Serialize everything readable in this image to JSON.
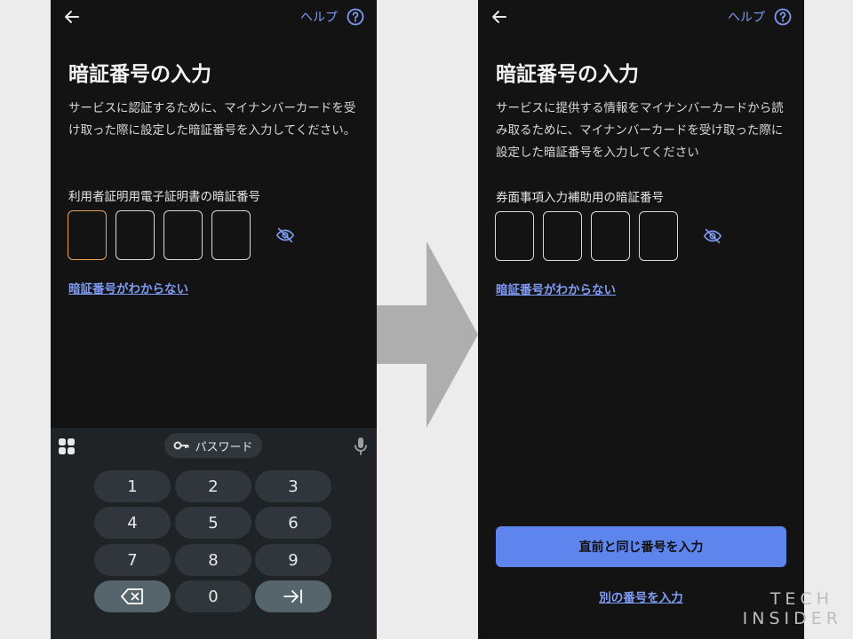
{
  "screens": [
    {
      "help_label": "ヘルプ",
      "title": "暗証番号の入力",
      "description": "サービスに認証するために、マイナンバーカードを受け取った際に設定した暗証番号を入力してください。",
      "field_label": "利用者証明用電子証明書の暗証番号",
      "pin_digits": 4,
      "focused_box": 1,
      "forgot_link": "暗証番号がわからない"
    },
    {
      "help_label": "ヘルプ",
      "title": "暗証番号の入力",
      "description": "サービスに提供する情報をマイナンバーカードから読み取るために、マイナンバーカードを受け取った際に設定した暗証番号を入力してください",
      "field_label": "券面事項入力補助用の暗証番号",
      "pin_digits": 4,
      "forgot_link": "暗証番号がわからない",
      "primary_button": "直前と同じ番号を入力",
      "secondary_link": "別の番号を入力"
    }
  ],
  "keyboard": {
    "chip_label": "パスワード",
    "keys": [
      "1",
      "2",
      "3",
      "4",
      "5",
      "6",
      "7",
      "8",
      "9",
      "0"
    ]
  },
  "logo": {
    "line1": "TECH",
    "line2": "INSIDER"
  },
  "colors": {
    "screen_bg": "#131313",
    "accent_link": "#7f9cf5",
    "focus_outline": "#e9a15a",
    "primary_button": "#5e85ee",
    "keyboard_bg": "#1f2326",
    "arrow": "#aeaeae"
  },
  "icons": {
    "back": "arrow-left-icon",
    "help": "help-circle-icon",
    "visibility": "eye-off-icon",
    "apps": "apps-grid-icon",
    "key": "key-icon",
    "mic": "microphone-icon",
    "backspace": "backspace-icon",
    "next": "tab-next-icon"
  }
}
